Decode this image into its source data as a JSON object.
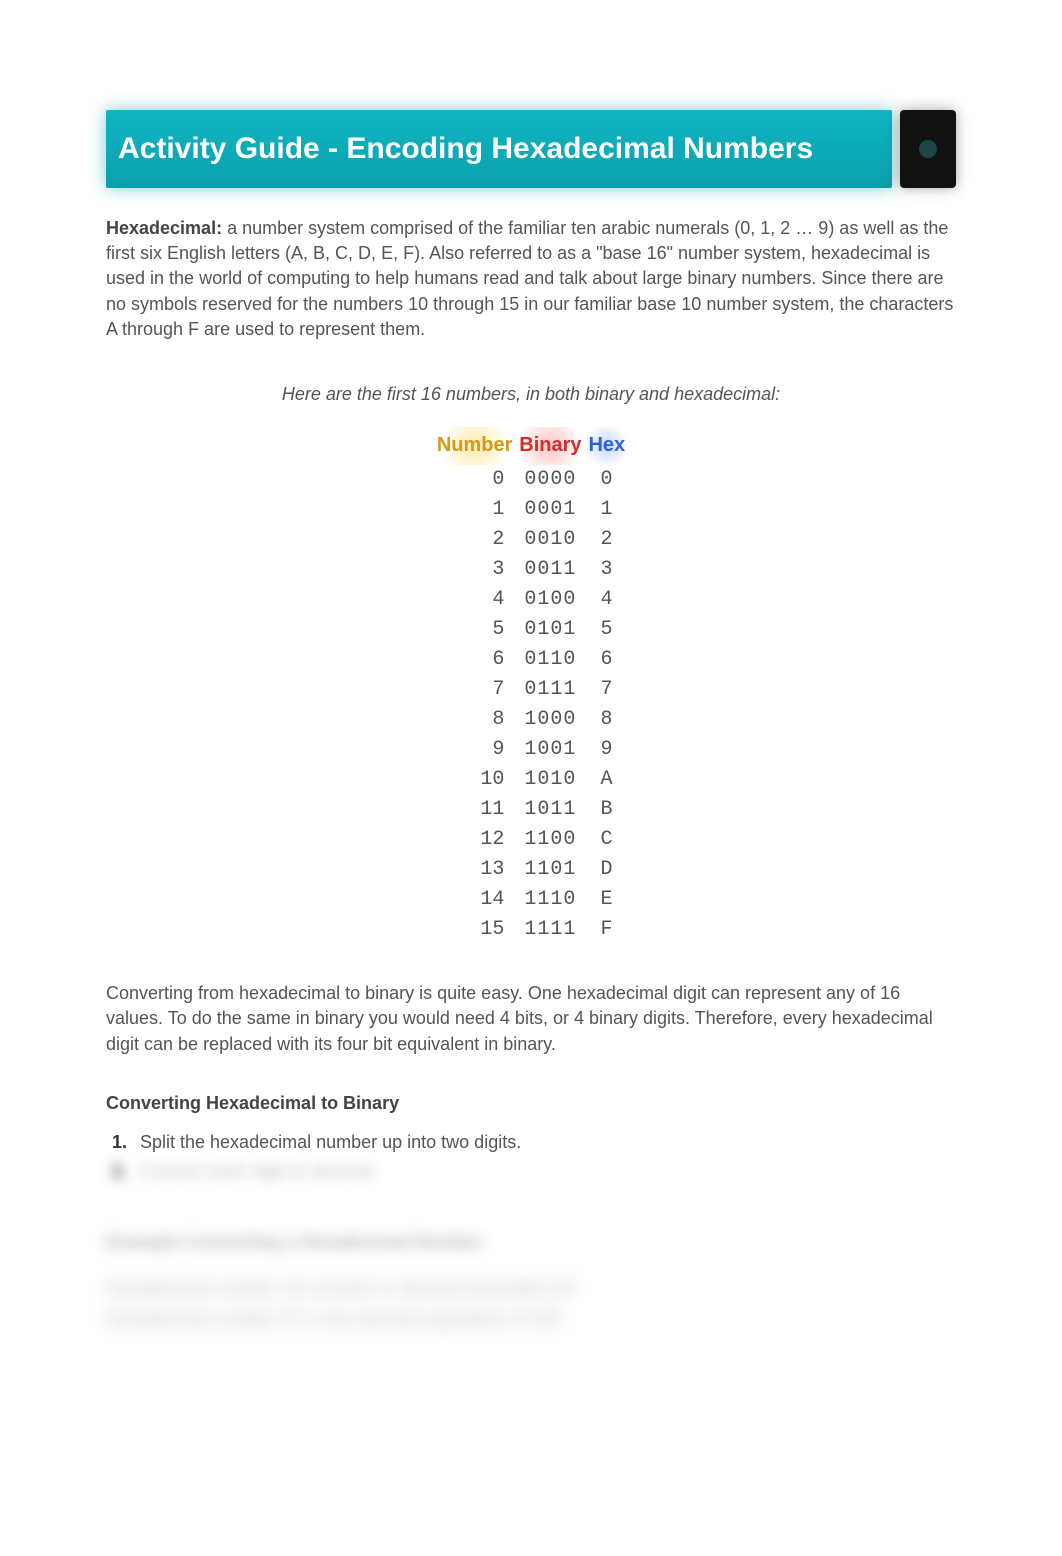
{
  "title": "Activity Guide - Encoding Hexadecimal Numbers",
  "intro_bold": "Hexadecimal:",
  "intro_text": " a number system comprised of the familiar ten arabic numerals (0, 1, 2 … 9) as well as the first six English letters (A, B, C, D, E, F). Also referred to as a \"base 16\" number system, hexadecimal is used in the world of computing to help humans read and talk about large binary numbers. Since there are no symbols reserved for the numbers 10 through 15 in our familiar base 10 number system, the characters A through F are used to represent them.",
  "caption": "Here are the first 16 numbers, in both binary and hexadecimal:",
  "table": {
    "headers": {
      "number": "Number",
      "binary": "Binary",
      "hex": "Hex"
    },
    "rows": [
      {
        "number": "0",
        "binary": "0000",
        "hex": "0"
      },
      {
        "number": "1",
        "binary": "0001",
        "hex": "1"
      },
      {
        "number": "2",
        "binary": "0010",
        "hex": "2"
      },
      {
        "number": "3",
        "binary": "0011",
        "hex": "3"
      },
      {
        "number": "4",
        "binary": "0100",
        "hex": "4"
      },
      {
        "number": "5",
        "binary": "0101",
        "hex": "5"
      },
      {
        "number": "6",
        "binary": "0110",
        "hex": "6"
      },
      {
        "number": "7",
        "binary": "0111",
        "hex": "7"
      },
      {
        "number": "8",
        "binary": "1000",
        "hex": "8"
      },
      {
        "number": "9",
        "binary": "1001",
        "hex": "9"
      },
      {
        "number": "10",
        "binary": "1010",
        "hex": "A"
      },
      {
        "number": "11",
        "binary": "1011",
        "hex": "B"
      },
      {
        "number": "12",
        "binary": "1100",
        "hex": "C"
      },
      {
        "number": "13",
        "binary": "1101",
        "hex": "D"
      },
      {
        "number": "14",
        "binary": "1110",
        "hex": "E"
      },
      {
        "number": "15",
        "binary": "1111",
        "hex": "F"
      }
    ]
  },
  "paragraph2": "Converting from hexadecimal to binary is quite easy. One hexadecimal digit can represent any of 16 values. To do the same in binary you would need 4 bits, or 4 binary digits. Therefore, every hexadecimal digit can be replaced with its four bit equivalent in binary.",
  "section_heading": "Converting Hexadecimal to Binary",
  "steps": [
    "Split the hexadecimal number up into two digits.",
    "Convert each digit to decimal."
  ],
  "blurred_heading": "Example Converting a Hexadecimal Number",
  "blurred_line_1": "Hexadecimal number 1A converts to decimal equivalent 26",
  "blurred_line_2": "Hexadecimal number FF is the decimal equivalent of 255"
}
